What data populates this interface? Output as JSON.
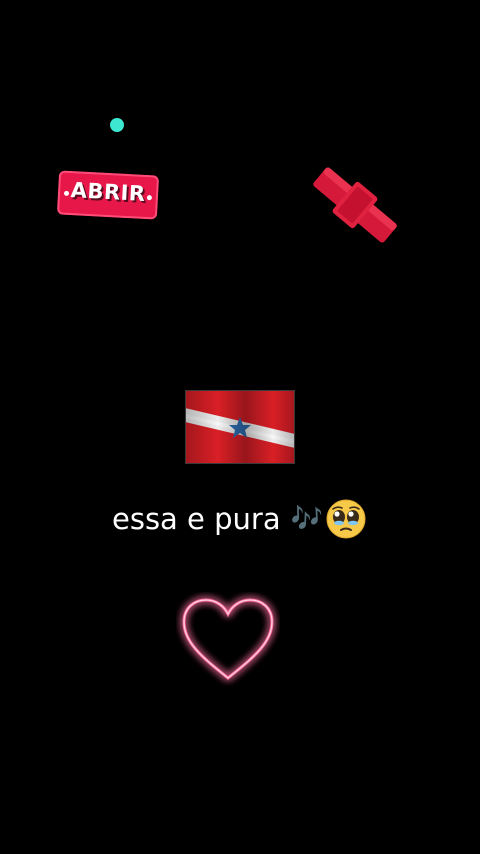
{
  "stickers": {
    "abrir_label": "ABRIR"
  },
  "caption": {
    "text": "essa e pura",
    "notes": "🎶"
  },
  "icons": {
    "dot": "teal-dot-icon",
    "bandage": "crossed-bandage-icon",
    "flag": "para-state-flag-icon",
    "face": "pleading-face-emoji-icon",
    "heart": "neon-heart-icon"
  },
  "colors": {
    "background": "#000000",
    "accent_teal": "#3ee8d0",
    "accent_pink": "#e8174a",
    "flag_red": "#d91f26",
    "heart_glow": "#ff6fa0"
  }
}
